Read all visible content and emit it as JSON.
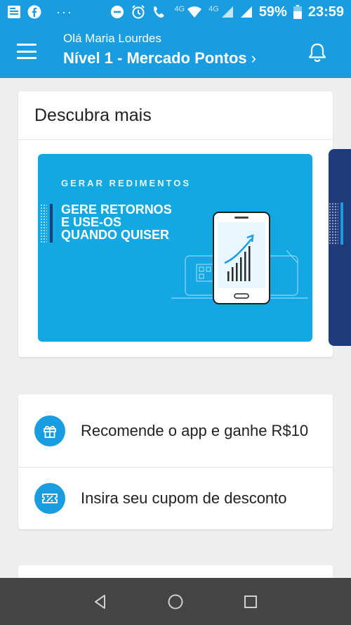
{
  "status_bar": {
    "network_label": "4G",
    "network_label_secondary": "4G",
    "battery": "59%",
    "time": "23:59"
  },
  "app_bar": {
    "greeting": "Olá Maria Lourdes",
    "level": "Nível 1 - Mercado Pontos"
  },
  "discover": {
    "title": "Descubra mais",
    "banner": {
      "tag": "GERAR REDIMENTOS",
      "headline": "GERE RETORNOS\nE USE-OS\nQUANDO QUISER"
    }
  },
  "actions": {
    "recommend": "Recomende o app e ganhe R$10",
    "coupon": "Insira seu cupom de desconto"
  },
  "colors": {
    "primary": "#1a9de0",
    "banner": "#14a8e3",
    "navy": "#1f3b7a",
    "nav_bar": "#454545"
  }
}
